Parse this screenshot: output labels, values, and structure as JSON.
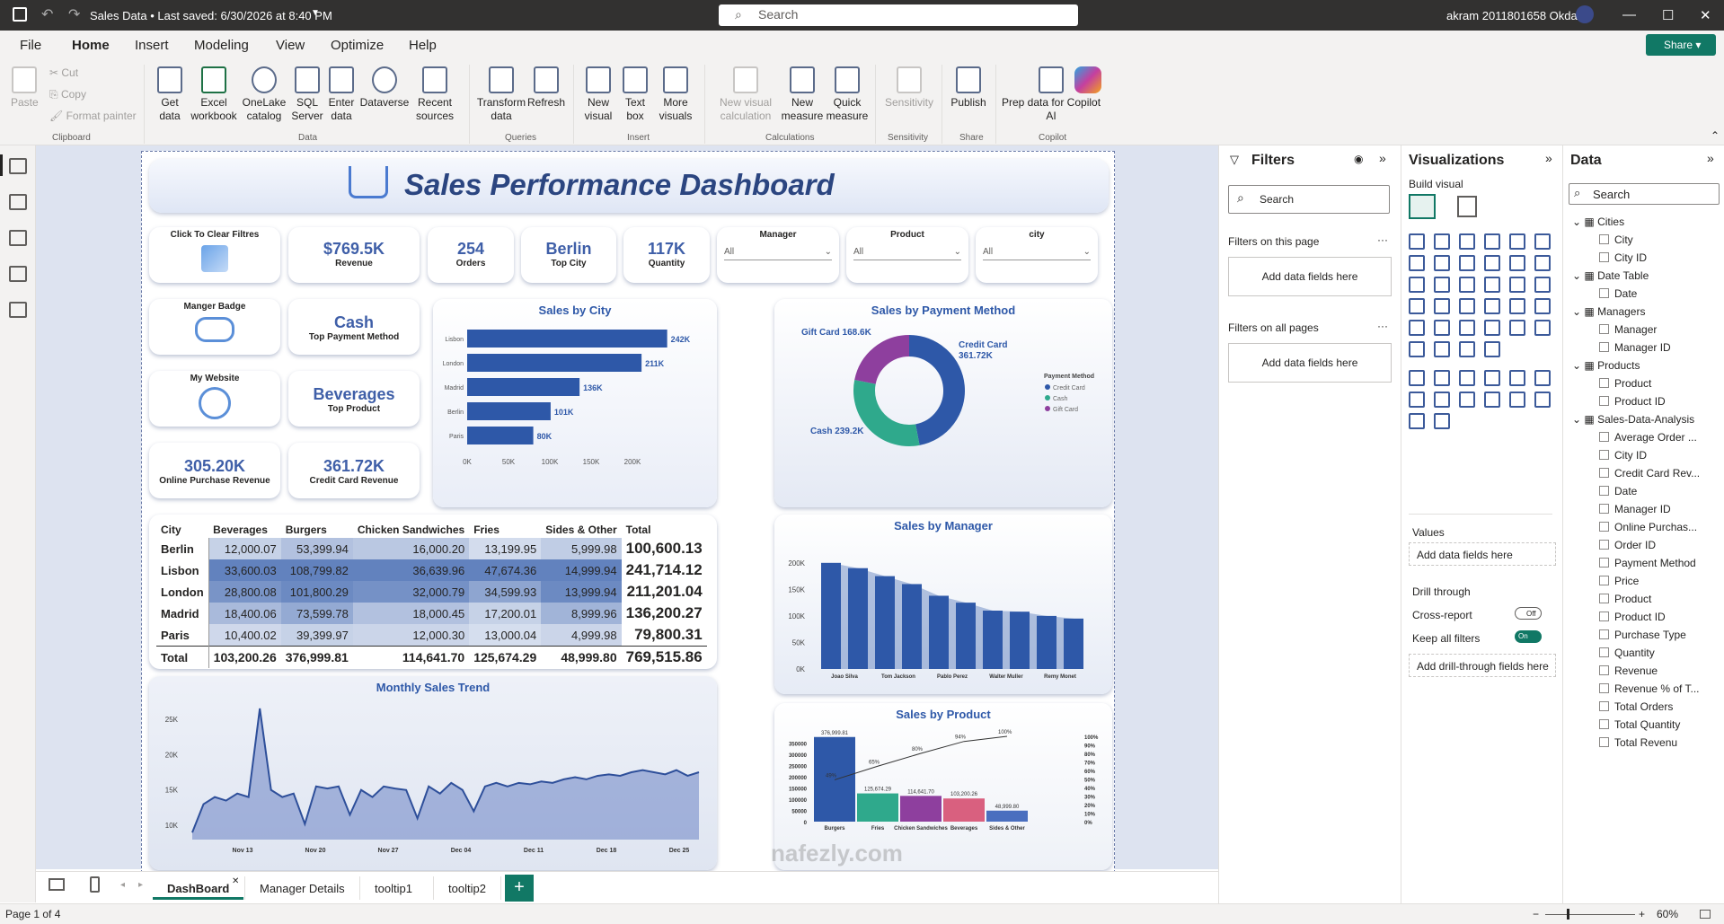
{
  "titlebar": {
    "doc_title": "Sales Data • Last saved: 6/30/2026 at 8:40 PM",
    "search_placeholder": "Search",
    "user": "akram 2011801658 Okda"
  },
  "menu": [
    "File",
    "Home",
    "Insert",
    "Modeling",
    "View",
    "Optimize",
    "Help"
  ],
  "share_label": "Share",
  "ribbon": {
    "clipboard": {
      "paste": "Paste",
      "cut": "Cut",
      "copy": "Copy",
      "format_painter": "Format painter",
      "group": "Clipboard"
    },
    "data": {
      "get_data": "Get data",
      "excel": "Excel workbook",
      "onelake": "OneLake catalog",
      "sql": "SQL Server",
      "enter": "Enter data",
      "dataverse": "Dataverse",
      "recent": "Recent sources",
      "group": "Data"
    },
    "queries": {
      "transform": "Transform data",
      "refresh": "Refresh",
      "group": "Queries"
    },
    "insert": {
      "new_visual": "New visual",
      "text_box": "Text box",
      "more_visuals": "More visuals",
      "group": "Insert"
    },
    "calculations": {
      "new_visual_calc": "New visual calculation",
      "new_measure": "New measure",
      "quick_measure": "Quick measure",
      "group": "Calculations"
    },
    "sensitivity": {
      "label": "Sensitivity",
      "group": "Sensitivity"
    },
    "share": {
      "publish": "Publish",
      "group": "Share"
    },
    "copilot": {
      "prep": "Prep data for Copilot AI",
      "group": "Copilot"
    }
  },
  "dashboard": {
    "title": "Sales Performance Dashboard",
    "buttons": {
      "clear": "Click To Clear Filtres",
      "manager_badge": "Manger Badge",
      "website": "My Website"
    },
    "kpis": [
      {
        "value": "$769.5K",
        "label": "Revenue"
      },
      {
        "value": "254",
        "label": "Orders"
      },
      {
        "value": "Berlin",
        "label": "Top City"
      },
      {
        "value": "117K",
        "label": "Quantity"
      },
      {
        "value": "Cash",
        "label": "Top Payment Method"
      },
      {
        "value": "Beverages",
        "label": "Top Product"
      },
      {
        "value": "305.20K",
        "label": "Online Purchase Revenue"
      },
      {
        "value": "361.72K",
        "label": "Credit Card Revenue"
      }
    ],
    "slicers": [
      {
        "title": "Manager",
        "value": "All"
      },
      {
        "title": "Product",
        "value": "All"
      },
      {
        "title": "city",
        "value": "All"
      }
    ],
    "matrix": {
      "headers": [
        "City",
        "Beverages",
        "Burgers",
        "Chicken Sandwiches",
        "Fries",
        "Sides & Other",
        "Total"
      ],
      "rows": [
        [
          "Berlin",
          "12,000.07",
          "53,399.94",
          "16,000.20",
          "13,199.95",
          "5,999.98",
          "100,600.13"
        ],
        [
          "Lisbon",
          "33,600.03",
          "108,799.82",
          "36,639.96",
          "47,674.36",
          "14,999.94",
          "241,714.12"
        ],
        [
          "London",
          "28,800.08",
          "101,800.29",
          "32,000.79",
          "34,599.93",
          "13,999.94",
          "211,201.04"
        ],
        [
          "Madrid",
          "18,400.06",
          "73,599.78",
          "18,000.45",
          "17,200.01",
          "8,999.96",
          "136,200.27"
        ],
        [
          "Paris",
          "10,400.02",
          "39,399.97",
          "12,000.30",
          "13,000.04",
          "4,999.98",
          "79,800.31"
        ],
        [
          "Total",
          "103,200.26",
          "376,999.81",
          "114,641.70",
          "125,674.29",
          "48,999.80",
          "769,515.86"
        ]
      ]
    }
  },
  "chart_data": [
    {
      "type": "bar",
      "title": "Sales by City",
      "orientation": "horizontal",
      "categories": [
        "Lisbon",
        "London",
        "Madrid",
        "Berlin",
        "Paris"
      ],
      "values": [
        242,
        211,
        136,
        101,
        80
      ],
      "data_labels": [
        "242K",
        "211K",
        "136K",
        "101K",
        "80K"
      ],
      "x_ticks": [
        "0K",
        "50K",
        "100K",
        "150K",
        "200K"
      ],
      "xlim": [
        0,
        250
      ],
      "unit": "K"
    },
    {
      "type": "pie",
      "title": "Sales by Payment Method",
      "donut": true,
      "legend_title": "Payment Method",
      "legend": [
        "Credit Card",
        "Cash",
        "Gift Card"
      ],
      "values": [
        361.72,
        239.2,
        168.6
      ],
      "data_labels": [
        "Credit Card 361.72K",
        "Cash 239.2K",
        "Gift Card 168.6K"
      ],
      "colors": [
        "#2e58a8",
        "#2fa98c",
        "#8e3f9e"
      ],
      "legend_position": "right"
    },
    {
      "type": "area",
      "title": "Sales by Manager",
      "categories": [
        "Joao Silva",
        "Tom Jackson",
        "Pablo Perez",
        "Walter Muller",
        "Remy Monet"
      ],
      "bars": [
        [
          200,
          190
        ],
        [
          175,
          160
        ],
        [
          138,
          125
        ],
        [
          110,
          108
        ],
        [
          100,
          95
        ]
      ],
      "y_ticks": [
        "0K",
        "50K",
        "100K",
        "150K",
        "200K"
      ],
      "ylim": [
        0,
        220
      ]
    },
    {
      "type": "area",
      "title": "Monthly Sales Trend",
      "x_ticks": [
        "Nov 13",
        "Nov 20",
        "Nov 27",
        "Dec 04",
        "Dec 11",
        "Dec 18",
        "Dec 25"
      ],
      "y_ticks": [
        "10K",
        "15K",
        "20K",
        "25K"
      ],
      "ylim": [
        8,
        27
      ],
      "values": [
        9,
        13,
        14,
        13.5,
        14.5,
        14,
        26.5,
        15,
        14,
        14.5,
        10.2,
        15.5,
        15.2,
        15.5,
        11.5,
        15,
        14,
        15.5,
        15.2,
        15,
        11,
        15.5,
        14.5,
        16,
        15,
        12,
        15.5,
        16,
        15.5,
        16,
        15.8,
        16.2,
        16,
        16.5,
        16.8,
        16.5,
        17,
        17.2,
        17,
        17.5,
        17.8,
        17.5,
        17.2,
        17.8,
        17,
        17.5
      ]
    },
    {
      "type": "bar",
      "title": "Sales by Product",
      "categories": [
        "Burgers",
        "Fries",
        "Chicken Sandwiches",
        "Beverages",
        "Sides & Other"
      ],
      "values": [
        376999.81,
        125674.29,
        114641.7,
        103200.26,
        48999.8
      ],
      "data_labels": [
        "376,999.81",
        "125,674.29",
        "114,641.70",
        "103,200.26",
        "48,999.80"
      ],
      "colors": [
        "#2e58a8",
        "#2fa98c",
        "#8e3f9e",
        "#d9607f",
        "#4a6fbf"
      ],
      "pareto": [
        "49%",
        "65%",
        "80%",
        "94%",
        "100%"
      ],
      "y_ticks": [
        "0",
        "50000",
        "100000",
        "150000",
        "200000",
        "250000",
        "300000",
        "350000"
      ],
      "ylim": [
        0,
        380000
      ],
      "y2_ticks": [
        "0%",
        "10%",
        "20%",
        "30%",
        "40%",
        "50%",
        "60%",
        "70%",
        "80%",
        "90%",
        "100%"
      ]
    }
  ],
  "filters": {
    "title": "Filters",
    "search": "Search",
    "on_page": "Filters on this page",
    "on_all": "Filters on all pages",
    "add": "Add data fields here"
  },
  "visualizations": {
    "title": "Visualizations",
    "build": "Build visual",
    "values": "Values",
    "add": "Add data fields here",
    "drill": "Drill through",
    "cross": "Cross-report",
    "cross_state": "Off",
    "keep": "Keep all filters",
    "keep_state": "On",
    "add_drill": "Add drill-through fields here"
  },
  "datapane": {
    "title": "Data",
    "search": "Search",
    "tables": [
      {
        "name": "Cities",
        "fields": [
          "City",
          "City ID"
        ]
      },
      {
        "name": "Date Table",
        "fields": [
          "Date"
        ]
      },
      {
        "name": "Managers",
        "fields": [
          "Manager",
          "Manager ID"
        ]
      },
      {
        "name": "Products",
        "fields": [
          "Product",
          "Product ID"
        ]
      },
      {
        "name": "Sales-Data-Analysis",
        "fields": [
          "Average Order ...",
          "City ID",
          "Credit Card Rev...",
          "Date",
          "Manager ID",
          "Online Purchas...",
          "Order ID",
          "Payment Method",
          "Price",
          "Product",
          "Product ID",
          "Purchase Type",
          "Quantity",
          "Revenue",
          "Revenue % of T...",
          "Total Orders",
          "Total Quantity",
          "Total Revenu"
        ]
      }
    ]
  },
  "tabs": [
    "DashBoard",
    "Manager Details",
    "tooltip1",
    "tooltip2"
  ],
  "status": {
    "page": "Page 1 of 4",
    "zoom": "60%"
  },
  "watermark": "nafezly.com"
}
